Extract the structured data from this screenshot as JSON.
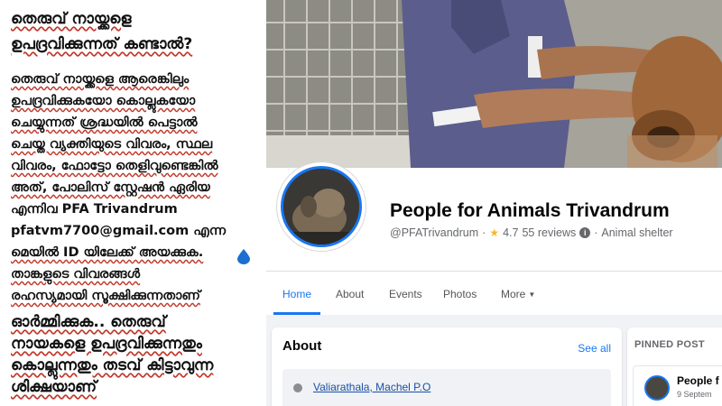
{
  "notice": {
    "heading_lines": [
      "തെരുവ് നായ്ക്കളെ",
      "ഉപദ്രവിക്കുന്നത് കണ്ടാൽ?"
    ],
    "body_lines": [
      "തെരുവ് നായ്ക്കളെ ആരെങ്കിലും",
      "ഉപദ്രവിക്കുകയോ കൊല്ലുകയോ",
      "ചെയ്യുന്നത് ശ്രദ്ധയിൽ പെട്ടാൽ",
      "ചെയ്ത വ്യക്തിയുടെ വിവരം, സ്ഥല",
      "വിവരം, ഫോട്ടോ തെളിവുണ്ടെങ്കിൽ",
      "അത്, പോലിസ് സ്റ്റേഷൻ ഏരിയ",
      "എന്നിവ PFA Trivandrum",
      "pfatvm7700@gmail.com എന്ന",
      "മെയിൽ ID യിലേക്ക് അയക്കുക.",
      "താങ്കളുടെ വിവരങ്ങൾ",
      "രഹസ്യമായി സൂക്ഷിക്കുന്നതാണ്"
    ],
    "closing_lines": [
      "ഓർമ്മിക്കുക.. തെരുവ്",
      "നായകളെ ഉപദ്രവിക്കുന്നതും",
      "കൊല്ലുന്നതും തടവ് കിട്ടാവുന്ന",
      "ശിക്ഷയാണ്"
    ]
  },
  "page": {
    "name": "People for Animals Trivandrum",
    "handle": "@PFATrivandrum",
    "separator": "·",
    "rating": "4.7",
    "reviews": "55 reviews",
    "category": "Animal shelter",
    "star_icon": "star-icon",
    "info_icon": "info-icon"
  },
  "tabs": [
    {
      "label": "Home",
      "active": true
    },
    {
      "label": "About",
      "active": false
    },
    {
      "label": "Events",
      "active": false
    },
    {
      "label": "Photos",
      "active": false
    },
    {
      "label": "More",
      "active": false
    }
  ],
  "about": {
    "title": "About",
    "see_all": "See all",
    "address": "Valiarathala, Machel P.O"
  },
  "pinned": {
    "title": "PINNED POST",
    "name": "People f",
    "date": "9 Septem"
  },
  "colors": {
    "accent": "#1877f2",
    "underline": "#c0392b",
    "background_feed": "#f0f2f5"
  }
}
